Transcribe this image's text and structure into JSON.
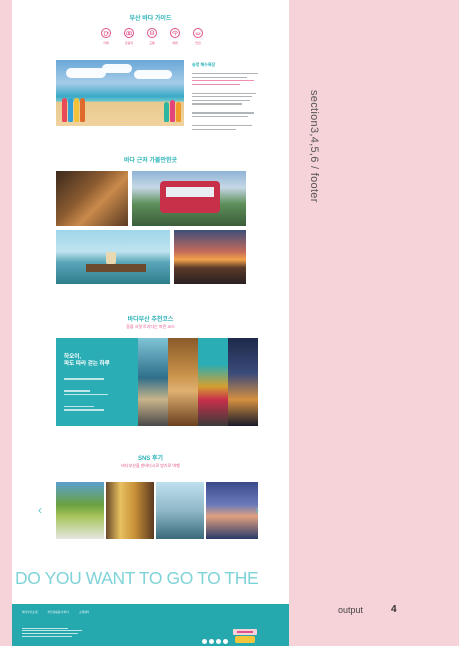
{
  "side_label": "section3,4,5,6 / footer",
  "output_label": "output",
  "page_number": "4",
  "guide": {
    "title": "부산 바다 가이드",
    "icons": [
      {
        "name": "coffee-icon",
        "label": "카페"
      },
      {
        "name": "camera-icon",
        "label": "관광지"
      },
      {
        "name": "bus-icon",
        "label": "교통"
      },
      {
        "name": "beach-icon",
        "label": "해변"
      },
      {
        "name": "food-icon",
        "label": "맛집"
      }
    ],
    "info_title": "송정 해수욕장"
  },
  "nearby": {
    "title": "바다 근처 가볼만한곳"
  },
  "course": {
    "title": "바다부산 추천코스",
    "subtitle": "동을 크릿 트기다는 마린 코스",
    "card_title_line1": "하오이,",
    "card_title_line2": "파도 따라 걷는 하루"
  },
  "sns": {
    "title": "SNS 후기",
    "subtitle": "바다부산을 한바다시로 방기로 여행",
    "prev": "‹",
    "next": "›"
  },
  "marquee": "DO YOU WANT TO GO TO THE",
  "footer": {
    "nav": [
      "바다부산소개",
      "부산관광공사 바다",
      "고객센터"
    ]
  },
  "colors": {
    "accent": "#2bb3b8",
    "pink": "#e0508a",
    "background": "#f6d3d8",
    "footer": "#26a9ae"
  }
}
